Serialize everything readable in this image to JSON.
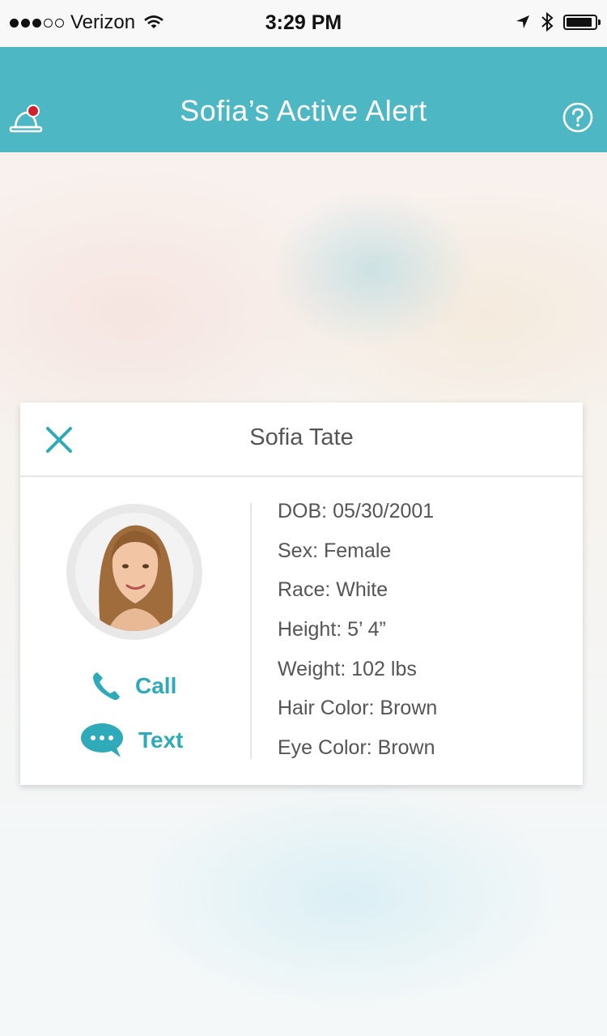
{
  "status_bar": {
    "carrier": "Verizon",
    "time": "3:29 PM",
    "signal_bars_filled": 3,
    "signal_bars_total": 5,
    "battery_level": 0.9
  },
  "header": {
    "title": "Sofia’s Active Alert",
    "background_color": "#4db8c4",
    "left_icon": "alert-bell-icon",
    "right_icon": "help-icon"
  },
  "profile": {
    "name": "Sofia Tate",
    "actions": {
      "call_label": "Call",
      "text_label": "Text"
    },
    "details": [
      "DOB: 05/30/2001",
      "Sex: Female",
      "Race: White",
      "Height: 5’ 4”",
      "Weight: 102 lbs",
      "Hair Color: Brown",
      "Eye Color: Brown"
    ]
  },
  "colors": {
    "accent": "#2eaab8",
    "alert_dot": "#d0202d"
  }
}
